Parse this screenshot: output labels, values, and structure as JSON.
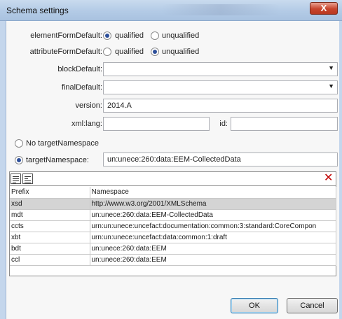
{
  "window": {
    "title": "Schema settings",
    "close_glyph": "X"
  },
  "form": {
    "elementFormDefault": {
      "label": "elementFormDefault:",
      "options": [
        "qualified",
        "unqualified"
      ],
      "selected": "qualified"
    },
    "attributeFormDefault": {
      "label": "attributeFormDefault:",
      "options": [
        "qualified",
        "unqualified"
      ],
      "selected": "unqualified"
    },
    "blockDefault": {
      "label": "blockDefault:",
      "value": ""
    },
    "finalDefault": {
      "label": "finalDefault:",
      "value": ""
    },
    "version": {
      "label": "version:",
      "value": "2014.A"
    },
    "xml_lang": {
      "label": "xml:lang:",
      "value": ""
    },
    "id": {
      "label": "id:",
      "value": ""
    }
  },
  "namespace_mode": {
    "no_target_label": "No targetNamespace",
    "target_label": "targetNamespace:",
    "selected": "targetNamespace",
    "target_value": "un:unece:260:data:EEM-CollectedData"
  },
  "namespaces": {
    "columns": [
      "Prefix",
      "Namespace"
    ],
    "rows": [
      {
        "prefix": "xsd",
        "namespace": "http://www.w3.org/2001/XMLSchema",
        "selected": true
      },
      {
        "prefix": "mdt",
        "namespace": "un:unece:260:data:EEM-CollectedData"
      },
      {
        "prefix": "ccts",
        "namespace": "urn:un:unece:uncefact:documentation:common:3:standard:CoreCompon"
      },
      {
        "prefix": "xbt",
        "namespace": "urn:un:unece:uncefact:data:common:1:draft"
      },
      {
        "prefix": "bdt",
        "namespace": "un:unece:260:data:EEM"
      },
      {
        "prefix": "ccl",
        "namespace": "un:unece:260:data:EEM"
      }
    ],
    "delete_glyph": "✕"
  },
  "buttons": {
    "ok": "OK",
    "cancel": "Cancel"
  },
  "icons": {
    "add_row": "list-add-icon",
    "insert_row": "list-insert-icon",
    "delete": "delete-x-icon",
    "dropdown": "chevron-down-icon"
  },
  "colors": {
    "titlebar": "#b3cbe6",
    "close": "#c7442c",
    "selected_row": "#d4d4d4",
    "delete": "#c00000",
    "radio_dot": "#2d4f9a"
  }
}
